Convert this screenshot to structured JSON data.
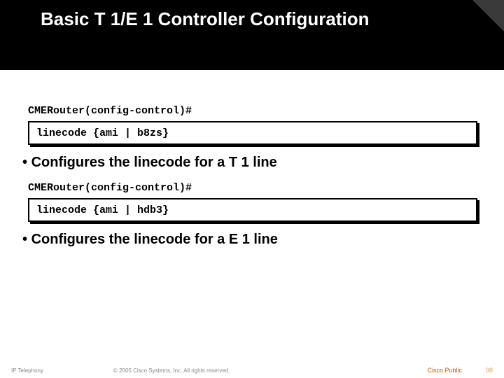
{
  "title": "Basic T 1/E 1 Controller Configuration",
  "block1": {
    "prompt": "CMERouter(config-control)#",
    "command": "linecode {ami | b8zs}",
    "bullet": "Configures the linecode for a T 1 line"
  },
  "block2": {
    "prompt": "CMERouter(config-control)#",
    "command": "linecode {ami | hdb3}",
    "bullet": "Configures the linecode for a E 1 line"
  },
  "footer": {
    "left": "IP Telephony",
    "center": "© 2005 Cisco Systems, Inc. All rights reserved.",
    "right": "Cisco Public",
    "page": "98"
  }
}
